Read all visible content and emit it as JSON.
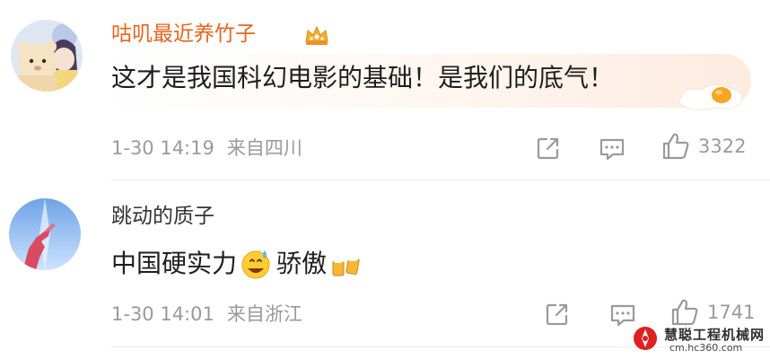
{
  "comments": [
    {
      "username": "咕叽最近养竹子",
      "username_color": "#e8641e",
      "badge_icon": "crown-icon",
      "text": "这才是我国科幻电影的基础！是我们的底气！",
      "decoration_icon": "fried-egg-icon",
      "time": "1-30 14:19",
      "location": "来自四川",
      "like_count": "3322"
    },
    {
      "username": "跳动的质子",
      "username_color": "#333333",
      "text_part1": "中国硬实力",
      "emoji1": "sweat-smile-emoji",
      "text_part2": "骄傲",
      "emoji2": "beer-cheers-emoji",
      "time": "1-30 14:01",
      "location": "来自浙江",
      "like_count": "1741"
    }
  ],
  "watermark": {
    "title": "慧聪工程机械网",
    "url": "cm.hc360.com"
  },
  "colors": {
    "meta_text": "#9a9a9a",
    "body_text": "#1e1e1e",
    "watermark_red": "#e02020"
  }
}
